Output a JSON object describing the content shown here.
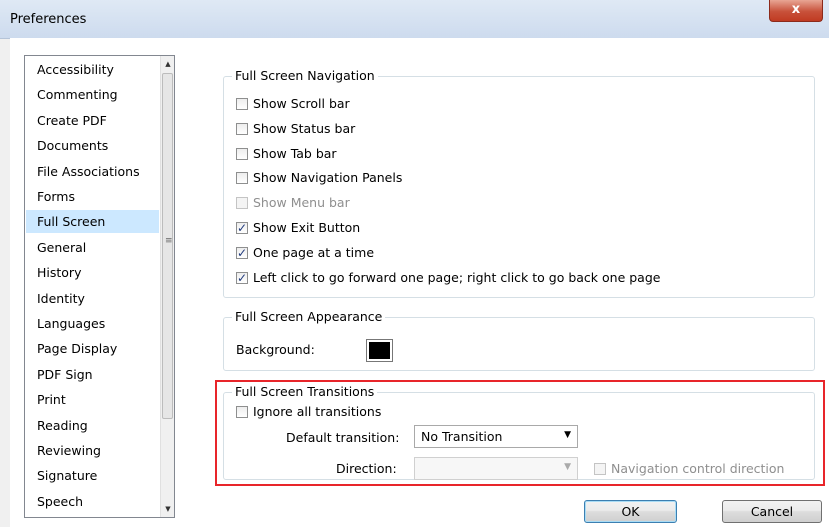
{
  "window": {
    "title": "Preferences",
    "close_label": "x"
  },
  "categories": [
    "Accessibility",
    "Commenting",
    "Create PDF",
    "Documents",
    "File Associations",
    "Forms",
    "Full Screen",
    "General",
    "History",
    "Identity",
    "Languages",
    "Page Display",
    "PDF Sign",
    "Print",
    "Reading",
    "Reviewing",
    "Signature",
    "Speech"
  ],
  "selected_category": "Full Screen",
  "navigation": {
    "title": "Full Screen Navigation",
    "options": [
      {
        "label": "Show Scroll bar",
        "checked": false,
        "enabled": true
      },
      {
        "label": "Show Status bar",
        "checked": false,
        "enabled": true
      },
      {
        "label": "Show Tab bar",
        "checked": false,
        "enabled": true
      },
      {
        "label": "Show Navigation Panels",
        "checked": false,
        "enabled": true
      },
      {
        "label": "Show Menu bar",
        "checked": false,
        "enabled": false
      },
      {
        "label": "Show Exit Button",
        "checked": true,
        "enabled": true
      },
      {
        "label": "One page at a time",
        "checked": true,
        "enabled": true
      },
      {
        "label": "Left click to go forward one page; right click to go back one page",
        "checked": true,
        "enabled": true
      }
    ]
  },
  "appearance": {
    "title": "Full Screen Appearance",
    "background_label": "Background:",
    "background_color": "#000000"
  },
  "transitions": {
    "title": "Full Screen Transitions",
    "ignore_label": "Ignore all transitions",
    "ignore_checked": false,
    "default_label": "Default transition:",
    "default_value": "No Transition",
    "direction_label": "Direction:",
    "direction_value": "",
    "nav_control_label": "Navigation control direction",
    "nav_control_checked": false
  },
  "buttons": {
    "ok": "OK",
    "cancel": "Cancel"
  },
  "colors": {
    "selection": "#cce8ff",
    "highlight_border": "#e8252a"
  }
}
